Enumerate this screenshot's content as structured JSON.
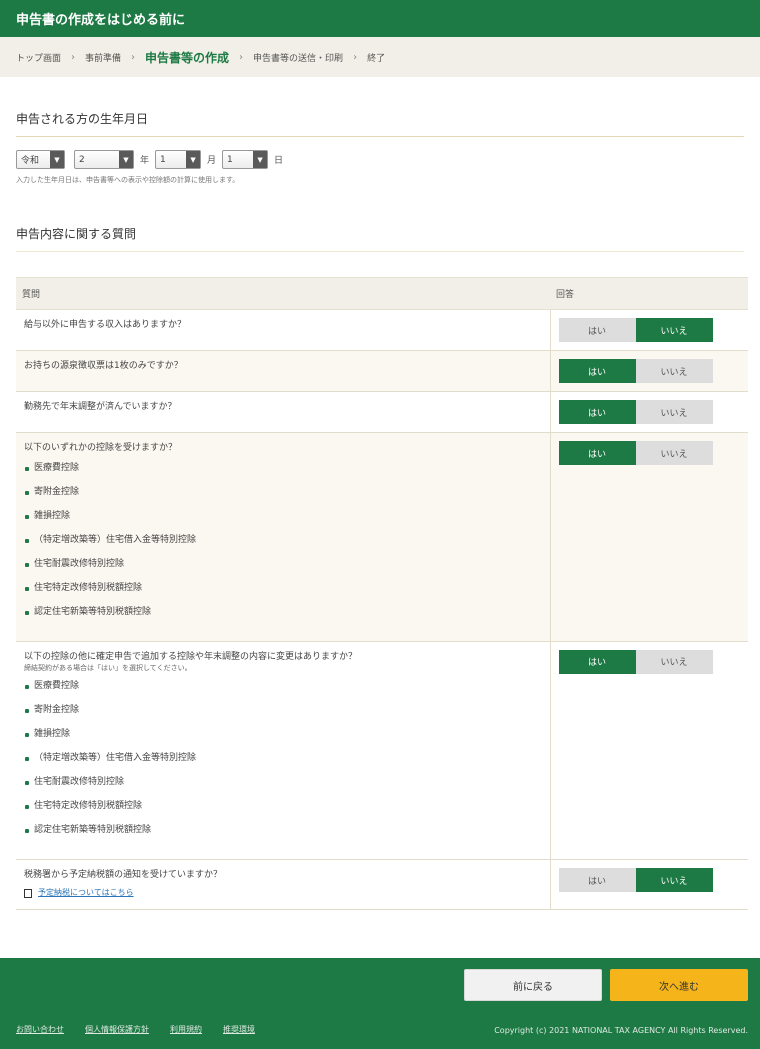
{
  "header": {
    "title": "申告書の作成をはじめる前に"
  },
  "breadcrumb": {
    "items": [
      "トップ画面",
      "事前準備",
      "申告書等の作成",
      "申告書等の送信・印刷",
      "終了"
    ],
    "current_index": 2
  },
  "birth": {
    "title": "申告される方の生年月日",
    "era": "令和",
    "year": "2",
    "year_unit": "年",
    "month": "1",
    "month_unit": "月",
    "day": "1",
    "day_unit": "日",
    "note": "入力した生年月日は、申告書等への表示や控除額の計算に使用します。"
  },
  "questions_section": {
    "title": "申告内容に関する質問",
    "col_question": "質問",
    "col_answer": "回答",
    "yes_label": "はい",
    "no_label": "いいえ",
    "items": [
      {
        "text": "給与以外に申告する収入はありますか？",
        "selected": "いいえ"
      },
      {
        "text": "お持ちの源泉徴収票は1枚のみですか？",
        "selected": "はい"
      },
      {
        "text": "勤務先で年末調整が済んでいますか？",
        "selected": "はい"
      },
      {
        "text": "以下のいずれかの控除を受けますか？",
        "selected": "はい",
        "bullets": [
          "医療費控除",
          "寄附金控除",
          "雑損控除",
          "（特定増改築等）住宅借入金等特別控除",
          "住宅耐震改修特別控除",
          "住宅特定改修特別税額控除",
          "認定住宅新築等特別税額控除"
        ]
      },
      {
        "text": "以下の控除の他に確定申告で追加する控除や年末調整の内容に変更はありますか？",
        "hint": "締結契約がある場合は「はい」を選択してください。",
        "selected": "はい",
        "bullets": [
          "医療費控除",
          "寄附金控除",
          "雑損控除",
          "（特定増改築等）住宅借入金等特別控除",
          "住宅耐震改修特別控除",
          "住宅特定改修特別税額控除",
          "認定住宅新築等特別税額控除"
        ]
      },
      {
        "text": "税務署から予定納税額の通知を受けていますか？",
        "link": "予定納税についてはこちら",
        "selected": "いいえ"
      }
    ]
  },
  "footer": {
    "back_label": "前に戻る",
    "next_label": "次へ進む",
    "links": [
      "お問い合わせ",
      "個人情報保護方針",
      "利用規約",
      "推奨環境"
    ],
    "copyright": "Copyright (c) 2021 NATIONAL TAX AGENCY All Rights Reserved."
  },
  "colors": {
    "brand_green": "#1e7a45",
    "next_button": "#f4b41a",
    "selected_answer": "#1e7a45",
    "unselected_answer": "#dddddd"
  }
}
